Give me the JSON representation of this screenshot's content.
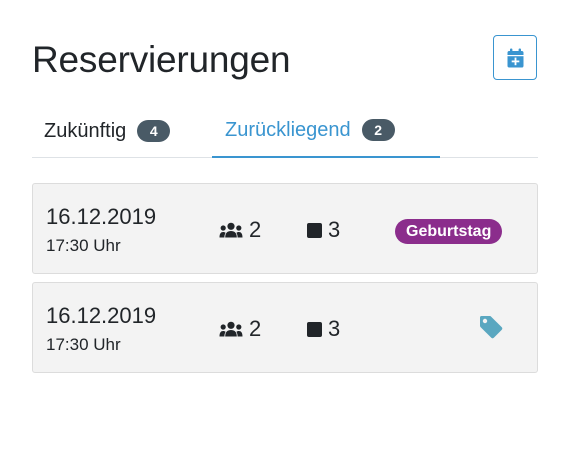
{
  "header": {
    "title": "Reservierungen",
    "add_icon": "calendar-plus-icon"
  },
  "tabs": [
    {
      "label": "Zukünftig",
      "count": "4",
      "active": false
    },
    {
      "label": "Zurückliegend",
      "count": "2",
      "active": true
    }
  ],
  "reservations": [
    {
      "date": "16.12.2019",
      "time": "17:30 Uhr",
      "guests": "2",
      "tables": "3",
      "occasion": "Geburtstag"
    },
    {
      "date": "16.12.2019",
      "time": "17:30 Uhr",
      "guests": "2",
      "tables": "3",
      "occasion": "",
      "tag_icon": "tag-icon"
    }
  ],
  "colors": {
    "accent": "#3a95d0",
    "badge": "#495a66",
    "occasion": "#8b2d8c",
    "tag_icon": "#5aa7c0"
  }
}
